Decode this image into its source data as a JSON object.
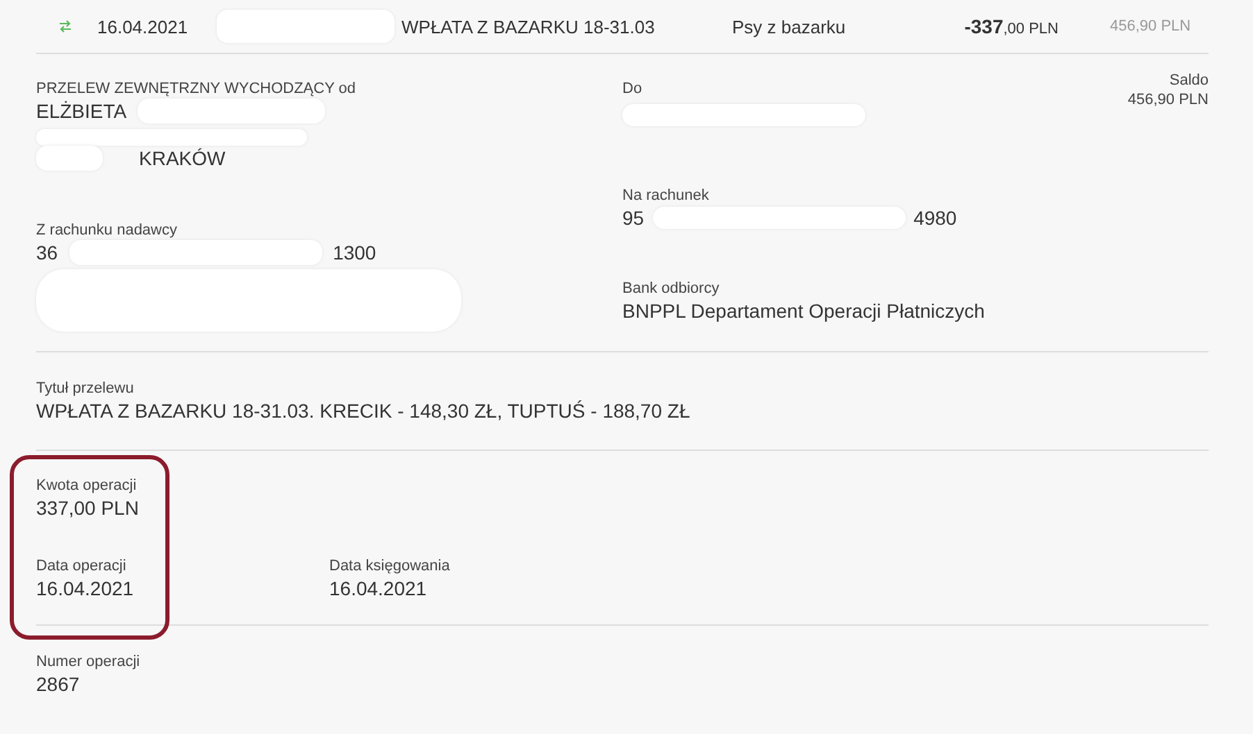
{
  "transaction": {
    "date": "16.04.2021",
    "title": "WPŁATA Z BAZARKU 18-31.03",
    "category": "Psy z bazarku",
    "amount": "**-337**,00 PLN",
    "balance": "456,90 PLN"
  },
  "details": {
    "sender": {
      "label": "PRZELEW ZEWNĘTRZNY WYCHODZĄCY od",
      "name": "ELŻBIETA",
      "city": "KRAKÓW"
    },
    "sender_account": {
      "label": "Z rachunku nadawcy",
      "start": "36",
      "end": "1300"
    },
    "recipient": {
      "label": "Do"
    },
    "recipient_account": {
      "label": "Na rachunek",
      "start": "95",
      "end": "4980"
    },
    "recipient_bank": {
      "label": "Bank odbiorcy",
      "value": "BNPPL Departament Operacji Płatniczych"
    },
    "saldo": {
      "label": "Saldo",
      "value": "456,90 PLN"
    },
    "transfer_title": {
      "label": "Tytuł przelewu",
      "value": "WPŁATA Z BAZARKU 18-31.03. KRECIK - 148,30 ZŁ, TUPTUŚ - 188,70 ZŁ"
    },
    "amount": {
      "label": "Kwota operacji",
      "value": "337,00 PLN"
    },
    "operation_date": {
      "label": "Data operacji",
      "value": "16.04.2021"
    },
    "booking_date": {
      "label": "Data księgowania",
      "value": "16.04.2021"
    },
    "operation_number": {
      "label": "Numer operacji",
      "value": "2867"
    }
  }
}
